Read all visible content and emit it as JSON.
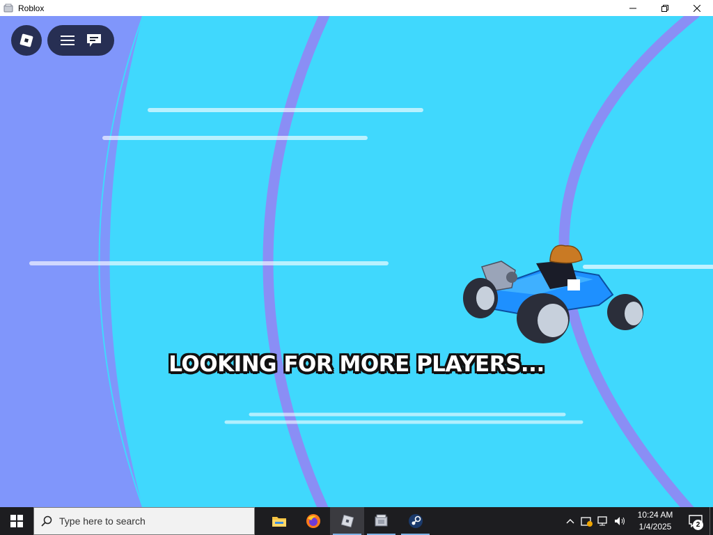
{
  "window": {
    "title": "Roblox",
    "minimize_glyph": "—",
    "restore_glyph": "❐",
    "close_glyph": "✕"
  },
  "game": {
    "status_text": "LOOKING FOR MORE PLAYERS...",
    "colors": {
      "sky": "#40d8fd",
      "outer_band": "#8096fb",
      "ring": "#8a8ef5"
    },
    "icons": [
      "roblox-logo-icon",
      "hamburger-menu-icon",
      "chat-icon"
    ]
  },
  "taskbar": {
    "search_placeholder": "Type here to search",
    "apps": [
      {
        "name": "file-explorer-icon",
        "active": false
      },
      {
        "name": "firefox-icon",
        "active": false
      },
      {
        "name": "roblox-icon",
        "active": true
      },
      {
        "name": "roblox-studio-icon",
        "active": true
      },
      {
        "name": "steam-icon",
        "active": true
      }
    ],
    "clock": {
      "time": "10:24 AM",
      "date": "1/4/2025"
    },
    "notification_count": "2"
  }
}
